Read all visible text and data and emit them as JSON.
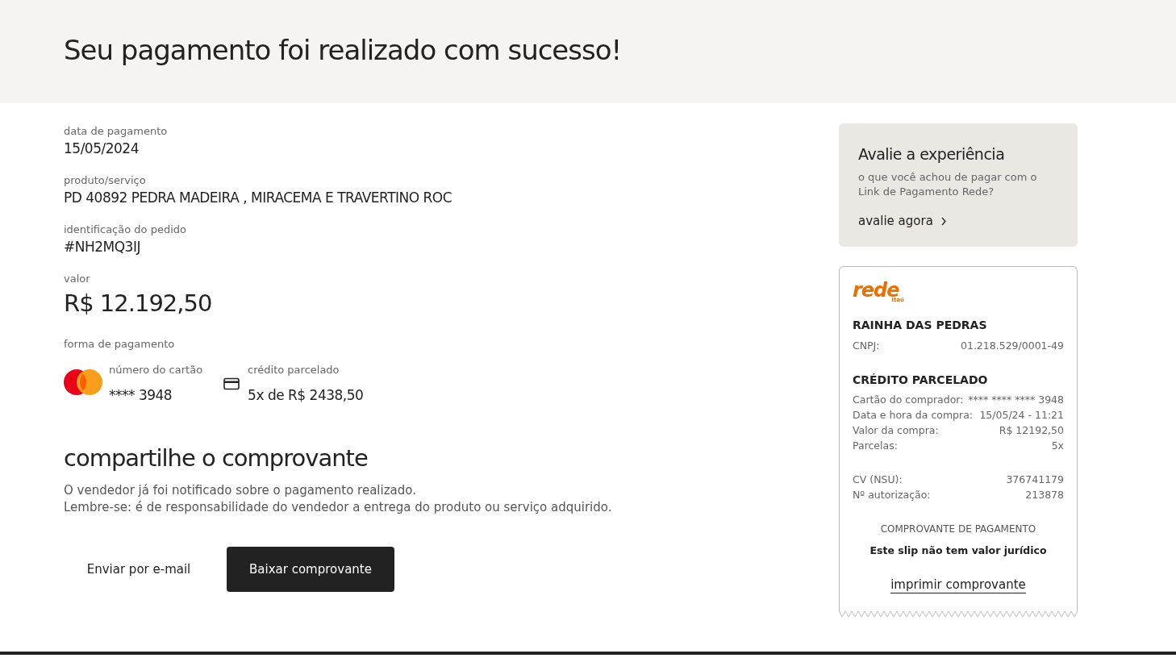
{
  "header": {
    "title": "Seu pagamento foi realizado com sucesso!"
  },
  "details": [
    {
      "label": "data de pagamento",
      "value": "15/05/2024",
      "kind": "normal"
    },
    {
      "label": "produto/serviço",
      "value": "PD 40892 PEDRA MADEIRA , MIRACEMA E TRAVERTINO ROC",
      "kind": "normal"
    },
    {
      "label": "identificação do pedido",
      "value": "#NH2MQ3IJ",
      "kind": "normal"
    },
    {
      "label": "valor",
      "value": "R$ 12.192,50",
      "kind": "large"
    }
  ],
  "payment": {
    "label": "forma de pagamento",
    "items": [
      {
        "kind": "card-brand",
        "label": "número do cartão",
        "value": "**** 3948"
      },
      {
        "kind": "installments",
        "label": "crédito parcelado",
        "value": "5x de R$ 2438,50"
      }
    ]
  },
  "share": {
    "title": "compartilhe o comprovante",
    "lines": [
      "O vendedor já foi notificado sobre o pagamento realizado.",
      "Lembre-se: é de responsabilidade do vendedor a entrega do produto ou serviço adquirido."
    ],
    "buttons": [
      {
        "label": "Enviar por e-mail",
        "kind": "text"
      },
      {
        "label": "Baixar comprovante",
        "kind": "primary"
      }
    ]
  },
  "rating": {
    "title": "Avalie a experiência",
    "text": "o que você achou de pagar com o Link de Pagamento Rede?",
    "link": "avalie agora"
  },
  "receipt": {
    "logo": "rede",
    "logo_sub": "Itaú",
    "merchant": "RAINHA DAS PEDRAS",
    "merchant_rows": [
      {
        "label": "CNPJ:",
        "value": "01.218.529/0001-49"
      }
    ],
    "section": "CRÉDITO PARCELADO",
    "rows": [
      {
        "label": "Cartão do comprador:",
        "value": "**** **** **** 3948"
      },
      {
        "label": "Data e hora da compra:",
        "value": "15/05/24 - 11:21"
      },
      {
        "label": "Valor da compra:",
        "value": "R$ 12192,50"
      },
      {
        "label": "Parcelas:",
        "value": "5x"
      }
    ],
    "rows_2": [
      {
        "label": "CV (NSU):",
        "value": "376741179"
      },
      {
        "label": "Nº autorização:",
        "value": "213878"
      }
    ],
    "footer_title": "COMPROVANTE DE PAGAMENTO",
    "footer_note": "Este slip não tem valor jurídico",
    "print_link": "imprimir comprovante"
  }
}
